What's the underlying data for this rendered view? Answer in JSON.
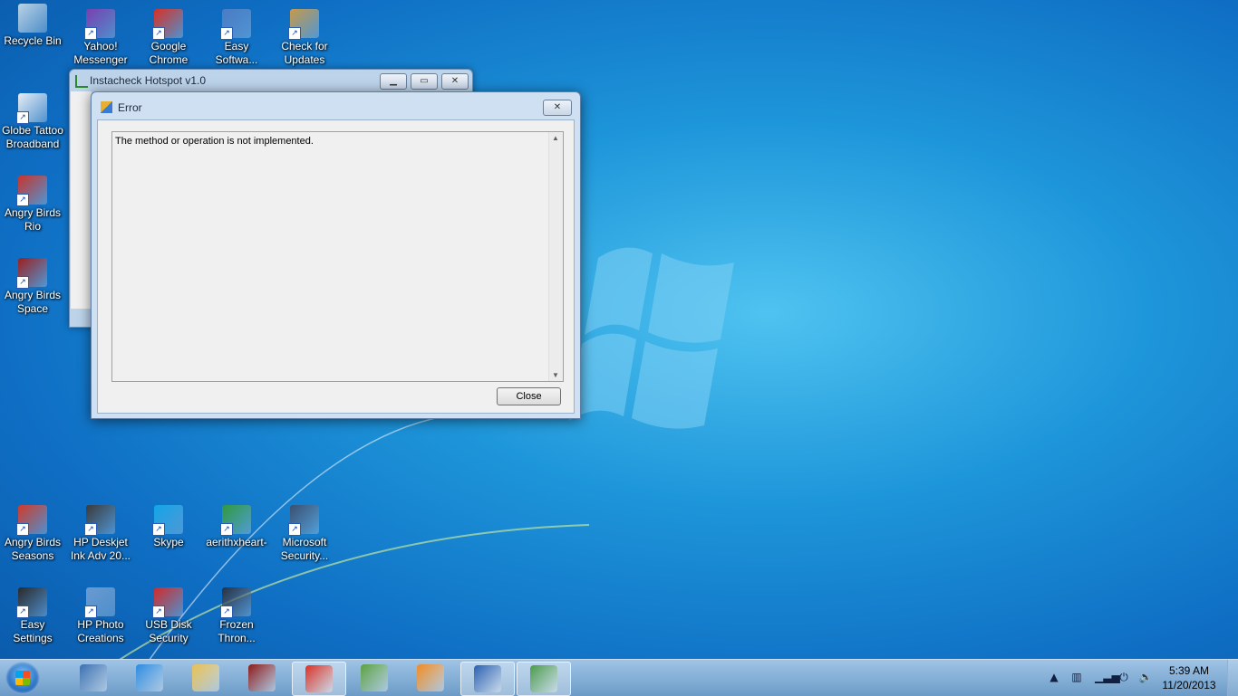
{
  "desktop": {
    "icons": [
      {
        "label": "Recycle Bin",
        "icon": "recycle-bin-icon",
        "color": "#b9d3e6"
      },
      {
        "label": "Yahoo! Messenger",
        "icon": "yahoo-messenger-icon",
        "color": "#7a3fb0"
      },
      {
        "label": "Google Chrome",
        "icon": "chrome-icon",
        "color": "#d93025"
      },
      {
        "label": "Easy Softwa...",
        "icon": "easy-software-icon",
        "color": "#4a7bc4"
      },
      {
        "label": "Check for Updates",
        "icon": "check-updates-icon",
        "color": "#c89a4a"
      },
      {
        "label": "Globe Tattoo Broadband",
        "icon": "globe-tattoo-icon",
        "color": "#e8eef5"
      },
      {
        "label": "Angry Birds Rio",
        "icon": "angry-birds-rio-icon",
        "color": "#c8342c"
      },
      {
        "label": "Angry Birds Space",
        "icon": "angry-birds-space-icon",
        "color": "#9b2020"
      },
      {
        "label": "Angry Birds Seasons",
        "icon": "angry-birds-seasons-icon",
        "color": "#d03a2a"
      },
      {
        "label": "HP Deskjet Ink Adv 20...",
        "icon": "printer-icon",
        "color": "#3a3a3a"
      },
      {
        "label": "Skype",
        "icon": "skype-icon",
        "color": "#12a5e8"
      },
      {
        "label": "aerithxheart-",
        "icon": "h-icon",
        "color": "#2e9a3c"
      },
      {
        "label": "Microsoft Security...",
        "icon": "security-icon",
        "color": "#3a4f70"
      },
      {
        "label": "Easy Settings",
        "icon": "easy-settings-icon",
        "color": "#2a2a2a"
      },
      {
        "label": "HP Photo Creations",
        "icon": "photo-icon",
        "color": "#6a9ad0"
      },
      {
        "label": "USB Disk Security",
        "icon": "usb-security-icon",
        "color": "#d02a2a"
      },
      {
        "label": "Frozen Thron...",
        "icon": "frozen-throne-icon",
        "color": "#283040"
      }
    ]
  },
  "back_window": {
    "title": "Instacheck Hotspot v1.0"
  },
  "error_dialog": {
    "title": "Error",
    "message": "The method or operation is not implemented.",
    "close_label": "Close"
  },
  "taskbar": {
    "items": [
      {
        "icon": "briefcase-icon",
        "color": "#3a6fb0",
        "active": false
      },
      {
        "icon": "internet-explorer-icon",
        "color": "#2a8ae0",
        "active": false
      },
      {
        "icon": "folder-icon",
        "color": "#e8c050",
        "active": false
      },
      {
        "icon": "angry-birds-space-icon",
        "color": "#8a1a1a",
        "active": false
      },
      {
        "icon": "chrome-icon",
        "color": "#d93025",
        "active": true
      },
      {
        "icon": "messenger-people-icon",
        "color": "#5aa040",
        "active": false
      },
      {
        "icon": "media-player-icon",
        "color": "#f08a20",
        "active": false
      },
      {
        "icon": "word-icon",
        "color": "#2a5fb0",
        "active": true
      },
      {
        "icon": "hotspot-app-icon",
        "color": "#4a9a4a",
        "active": true
      }
    ],
    "clock": {
      "time": "5:39 AM",
      "date": "11/20/2013"
    }
  }
}
